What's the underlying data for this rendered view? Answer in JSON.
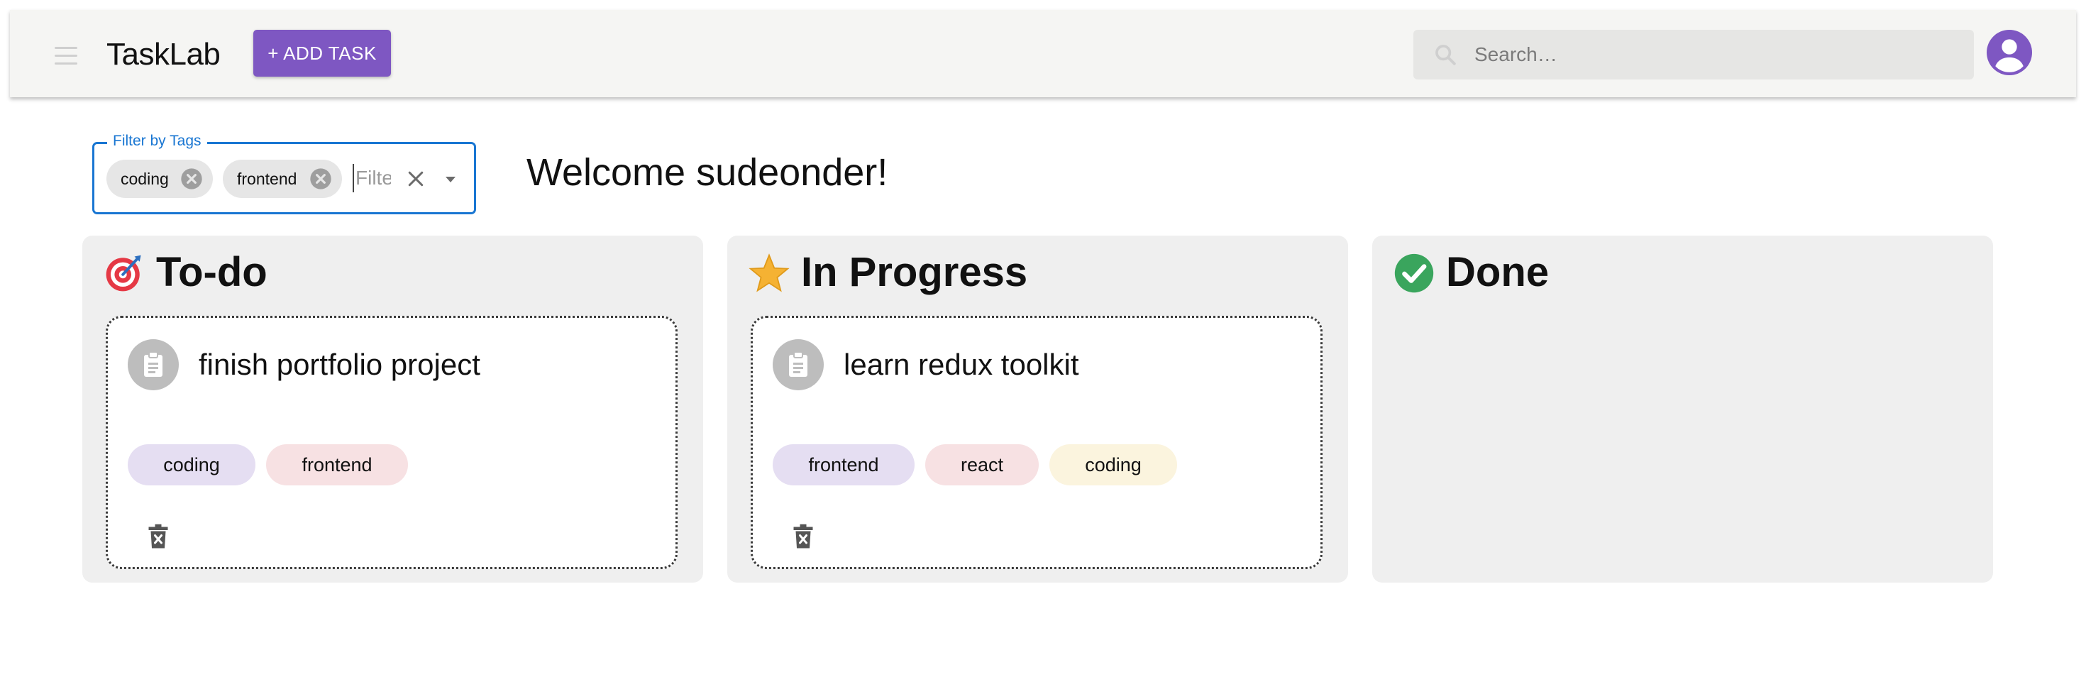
{
  "header": {
    "app_title": "TaskLab",
    "add_task_label": "+ ADD TASK",
    "search_placeholder": "Search…",
    "menu_icon": "menu-icon",
    "search_icon": "search-icon",
    "avatar_icon": "account-circle-icon"
  },
  "filter": {
    "label": "Filter by Tags",
    "chips": [
      "coding",
      "frontend"
    ],
    "input_placeholder": "Filter",
    "clear_icon": "close-icon",
    "dropdown_icon": "arrow-drop-down-icon"
  },
  "welcome_text": "Welcome sudeonder!",
  "columns": [
    {
      "title": "To-do",
      "icon": "target-icon",
      "cards": [
        {
          "title": "finish portfolio project",
          "tags": [
            "coding",
            "frontend"
          ]
        }
      ]
    },
    {
      "title": "In Progress",
      "icon": "star-icon",
      "cards": [
        {
          "title": "learn redux toolkit",
          "tags": [
            "frontend",
            "react",
            "coding"
          ]
        }
      ]
    },
    {
      "title": "Done",
      "icon": "check-circle-icon",
      "cards": []
    }
  ],
  "colors": {
    "accent": "#7e57c2",
    "focus_blue": "#1976d2",
    "done_green": "#3aa55d",
    "tag_purple": "#e5def2",
    "tag_pink": "#f7e1e3",
    "tag_cream": "#fbf4de"
  }
}
